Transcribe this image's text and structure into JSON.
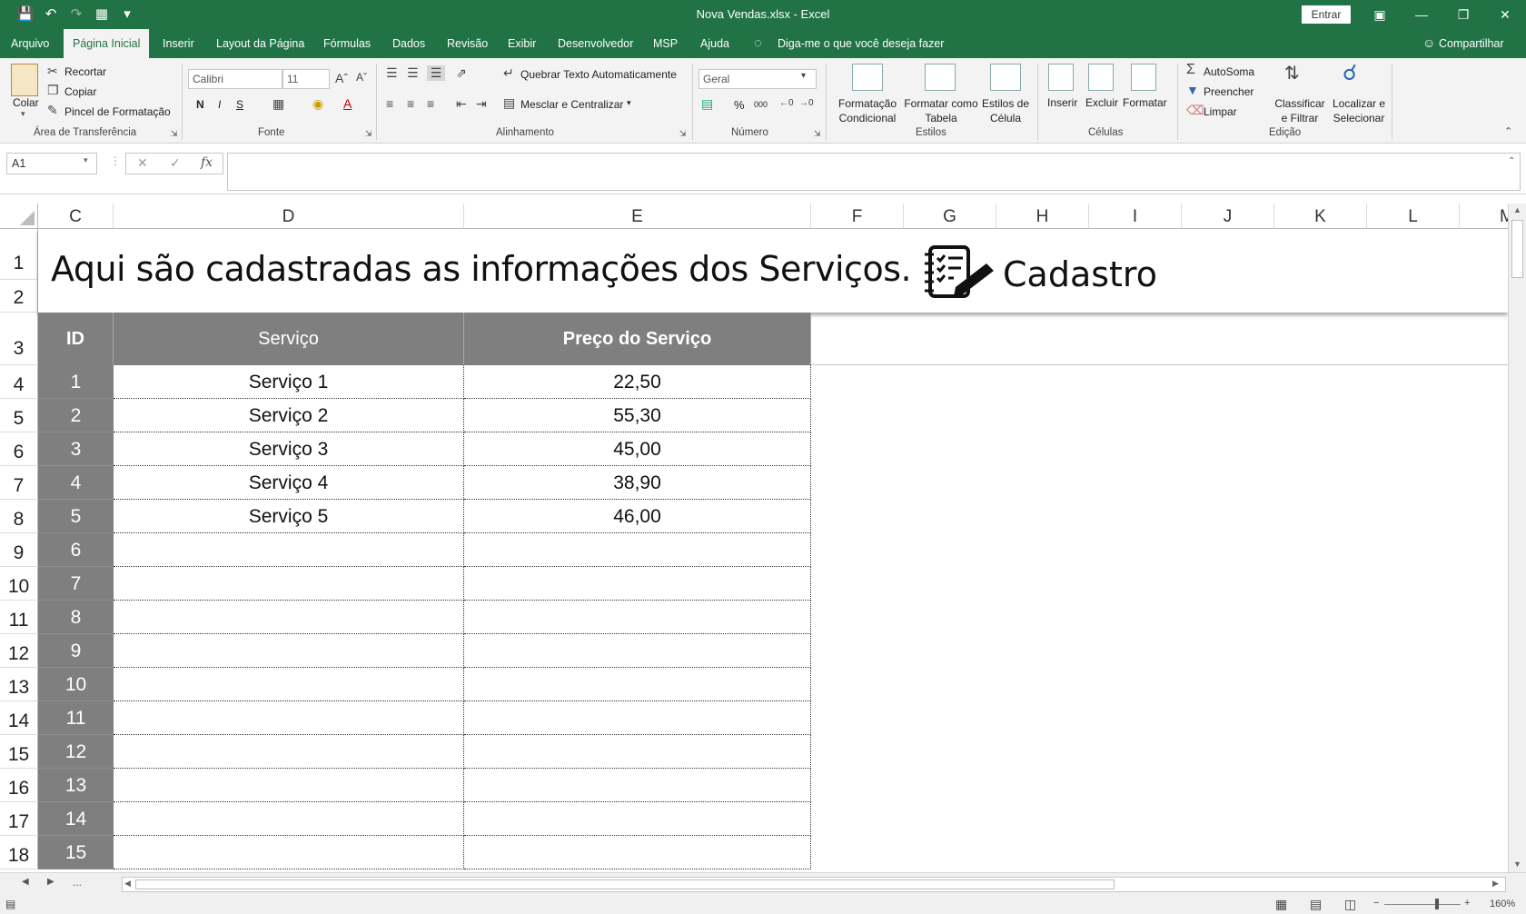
{
  "window": {
    "title": "Nova Vendas.xlsx  -  Excel",
    "signin": "Entrar"
  },
  "tabs": [
    "Arquivo",
    "Página Inicial",
    "Inserir",
    "Layout da Página",
    "Fórmulas",
    "Dados",
    "Revisão",
    "Exibir",
    "Desenvolvedor",
    "MSP",
    "Ajuda"
  ],
  "tell_me": "Diga-me o que você deseja fazer",
  "share": "Compartilhar",
  "ribbon": {
    "clipboard": {
      "paste": "Colar",
      "cut": "Recortar",
      "copy": "Copiar",
      "painter": "Pincel de Formatação",
      "label": "Área de Transferência"
    },
    "font": {
      "name": "Calibri",
      "size": "11",
      "bold": "N",
      "italic": "I",
      "underline": "S",
      "label": "Fonte"
    },
    "alignment": {
      "wrap": "Quebrar Texto Automaticamente",
      "merge": "Mesclar e Centralizar",
      "label": "Alinhamento"
    },
    "number": {
      "format": "Geral",
      "percent": "%",
      "thousands": "000",
      "label": "Número"
    },
    "styles": {
      "conditional": "Formatação Condicional",
      "as_table": "Formatar como Tabela",
      "cell_styles": "Estilos de Célula",
      "label": "Estilos"
    },
    "cells": {
      "insert": "Inserir",
      "delete": "Excluir",
      "format": "Formatar",
      "label": "Células"
    },
    "editing": {
      "autosum": "AutoSoma",
      "fill": "Preencher",
      "clear": "Limpar",
      "sort": "Classificar e Filtrar",
      "find": "Localizar e Selecionar",
      "label": "Edição"
    }
  },
  "formula_bar": {
    "name_box": "A1",
    "fx": "fx",
    "value": ""
  },
  "columns": [
    "C",
    "D",
    "E",
    "F",
    "G",
    "H",
    "I",
    "J",
    "K",
    "L",
    "M"
  ],
  "rows": [
    "1",
    "2",
    "3",
    "4",
    "5",
    "6",
    "7",
    "8",
    "9",
    "10",
    "11",
    "12",
    "13",
    "14",
    "15",
    "16",
    "17",
    "18"
  ],
  "sheet": {
    "heading": "Aqui são cadastradas as informações dos Serviços.",
    "badge": "Cadastro",
    "headers": {
      "id": "ID",
      "service": "Serviço",
      "price": "Preço do Serviço"
    },
    "records": [
      {
        "id": "1",
        "service": "Serviço 1",
        "price": "22,50"
      },
      {
        "id": "2",
        "service": "Serviço 2",
        "price": "55,30"
      },
      {
        "id": "3",
        "service": "Serviço 3",
        "price": "45,00"
      },
      {
        "id": "4",
        "service": "Serviço 4",
        "price": "38,90"
      },
      {
        "id": "5",
        "service": "Serviço 5",
        "price": "46,00"
      },
      {
        "id": "6",
        "service": "",
        "price": ""
      },
      {
        "id": "7",
        "service": "",
        "price": ""
      },
      {
        "id": "8",
        "service": "",
        "price": ""
      },
      {
        "id": "9",
        "service": "",
        "price": ""
      },
      {
        "id": "10",
        "service": "",
        "price": ""
      },
      {
        "id": "11",
        "service": "",
        "price": ""
      },
      {
        "id": "12",
        "service": "",
        "price": ""
      },
      {
        "id": "13",
        "service": "",
        "price": ""
      },
      {
        "id": "14",
        "service": "",
        "price": ""
      },
      {
        "id": "15",
        "service": "",
        "price": ""
      }
    ]
  },
  "sheet_nav": {
    "more": "..."
  },
  "status": {
    "zoom": "160%"
  },
  "colors": {
    "excel_green": "#217346",
    "table_header": "#7f7f7f"
  }
}
